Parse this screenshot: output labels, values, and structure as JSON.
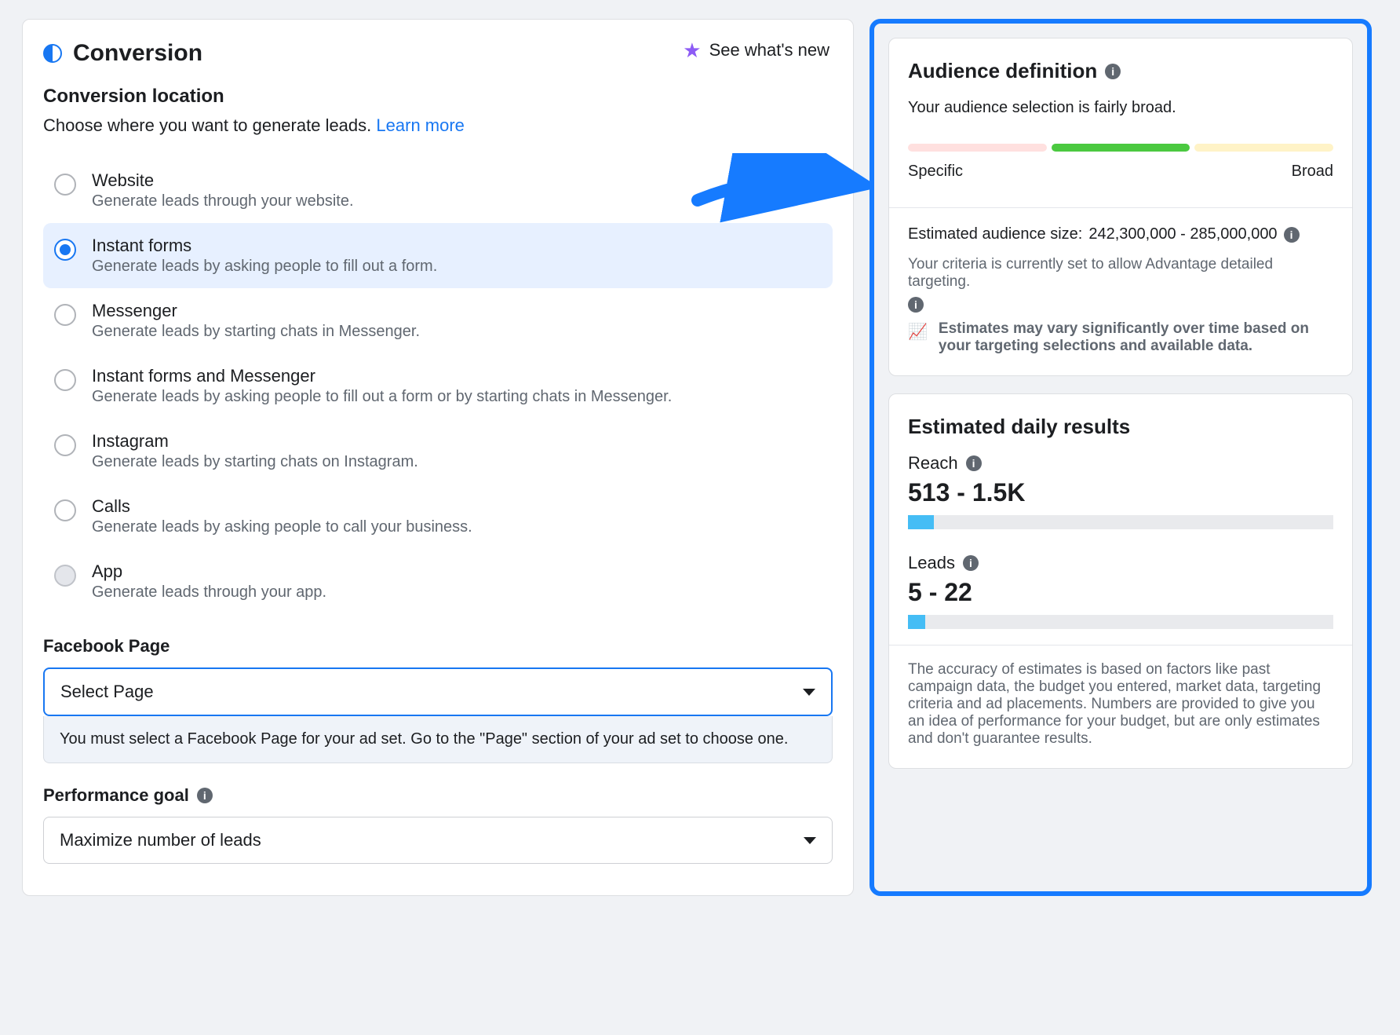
{
  "header": {
    "title": "Conversion",
    "whats_new": "See what's new"
  },
  "conversion": {
    "subheading": "Conversion location",
    "description": "Choose where you want to generate leads.",
    "learn_more": "Learn more"
  },
  "location_options": [
    {
      "title": "Website",
      "subtitle": "Generate leads through your website.",
      "selected": false,
      "disabled": false
    },
    {
      "title": "Instant forms",
      "subtitle": "Generate leads by asking people to fill out a form.",
      "selected": true,
      "disabled": false
    },
    {
      "title": "Messenger",
      "subtitle": "Generate leads by starting chats in Messenger.",
      "selected": false,
      "disabled": false
    },
    {
      "title": "Instant forms and Messenger",
      "subtitle": "Generate leads by asking people to fill out a form or by starting chats in Messenger.",
      "selected": false,
      "disabled": false
    },
    {
      "title": "Instagram",
      "subtitle": "Generate leads by starting chats on Instagram.",
      "selected": false,
      "disabled": false
    },
    {
      "title": "Calls",
      "subtitle": "Generate leads by asking people to call your business.",
      "selected": false,
      "disabled": false
    },
    {
      "title": "App",
      "subtitle": "Generate leads through your app.",
      "selected": false,
      "disabled": true
    }
  ],
  "facebook_page": {
    "label": "Facebook Page",
    "placeholder": "Select Page",
    "notice": "You must select a Facebook Page for your ad set. Go to the \"Page\" section of your ad set to choose one."
  },
  "performance_goal": {
    "label": "Performance goal",
    "selected": "Maximize number of leads"
  },
  "audience": {
    "heading": "Audience definition",
    "summary": "Your audience selection is fairly broad.",
    "label_specific": "Specific",
    "label_broad": "Broad",
    "est_label": "Estimated audience size:",
    "est_value": "242,300,000 - 285,000,000",
    "criteria_text": "Your criteria is currently set to allow Advantage detailed targeting.",
    "variance_note": "Estimates may vary significantly over time based on your targeting selections and available data."
  },
  "daily": {
    "heading": "Estimated daily results",
    "reach_label": "Reach",
    "reach_value": "513 - 1.5K",
    "reach_fill_pct": 6,
    "leads_label": "Leads",
    "leads_value": "5 - 22",
    "leads_fill_pct": 4,
    "footer": "The accuracy of estimates is based on factors like past campaign data, the budget you entered, market data, targeting criteria and ad placements. Numbers are provided to give you an idea of performance for your budget, but are only estimates and don't guarantee results."
  }
}
